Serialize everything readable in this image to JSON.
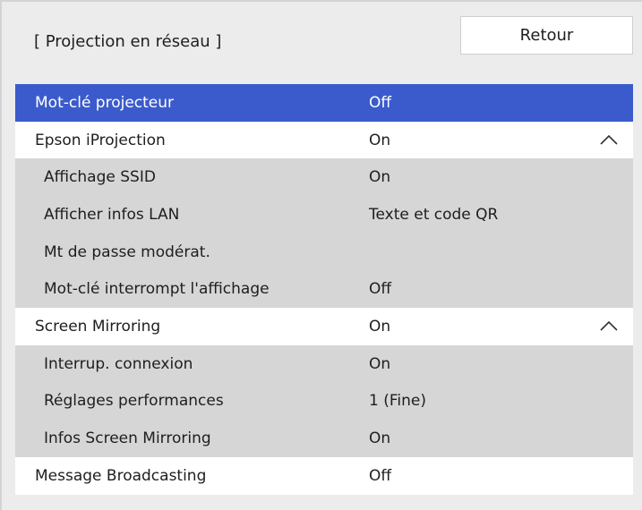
{
  "header": {
    "title": "[ Projection en réseau ]",
    "back_label": "Retour"
  },
  "menu": {
    "items": [
      {
        "label": "Mot-clé projecteur",
        "value": "Off",
        "level": "top",
        "selected": true,
        "expander": ""
      },
      {
        "label": "Epson iProjection",
        "value": "On",
        "level": "top",
        "selected": false,
        "expander": "chevron-up-icon"
      },
      {
        "label": "Affichage SSID",
        "value": "On",
        "level": "sub",
        "selected": false,
        "expander": ""
      },
      {
        "label": "Afficher infos LAN",
        "value": "Texte et code QR",
        "level": "sub",
        "selected": false,
        "expander": ""
      },
      {
        "label": "Mt de passe modérat.",
        "value": "",
        "level": "sub",
        "selected": false,
        "expander": ""
      },
      {
        "label": "Mot-clé interrompt l'affichage",
        "value": "Off",
        "level": "sub",
        "selected": false,
        "expander": ""
      },
      {
        "label": "Screen Mirroring",
        "value": "On",
        "level": "top",
        "selected": false,
        "expander": "chevron-up-icon"
      },
      {
        "label": "Interrup. connexion",
        "value": "On",
        "level": "sub",
        "selected": false,
        "expander": ""
      },
      {
        "label": "Réglages performances",
        "value": "1 (Fine)",
        "level": "sub",
        "selected": false,
        "expander": ""
      },
      {
        "label": "Infos Screen Mirroring",
        "value": "On",
        "level": "sub",
        "selected": false,
        "expander": ""
      },
      {
        "label": "Message Broadcasting",
        "value": "Off",
        "level": "top",
        "selected": false,
        "expander": ""
      }
    ]
  },
  "colors": {
    "selected_row": "#3b5bcc",
    "top_row": "#ffffff",
    "sub_row": "#d6d6d6",
    "panel": "#ececec"
  }
}
